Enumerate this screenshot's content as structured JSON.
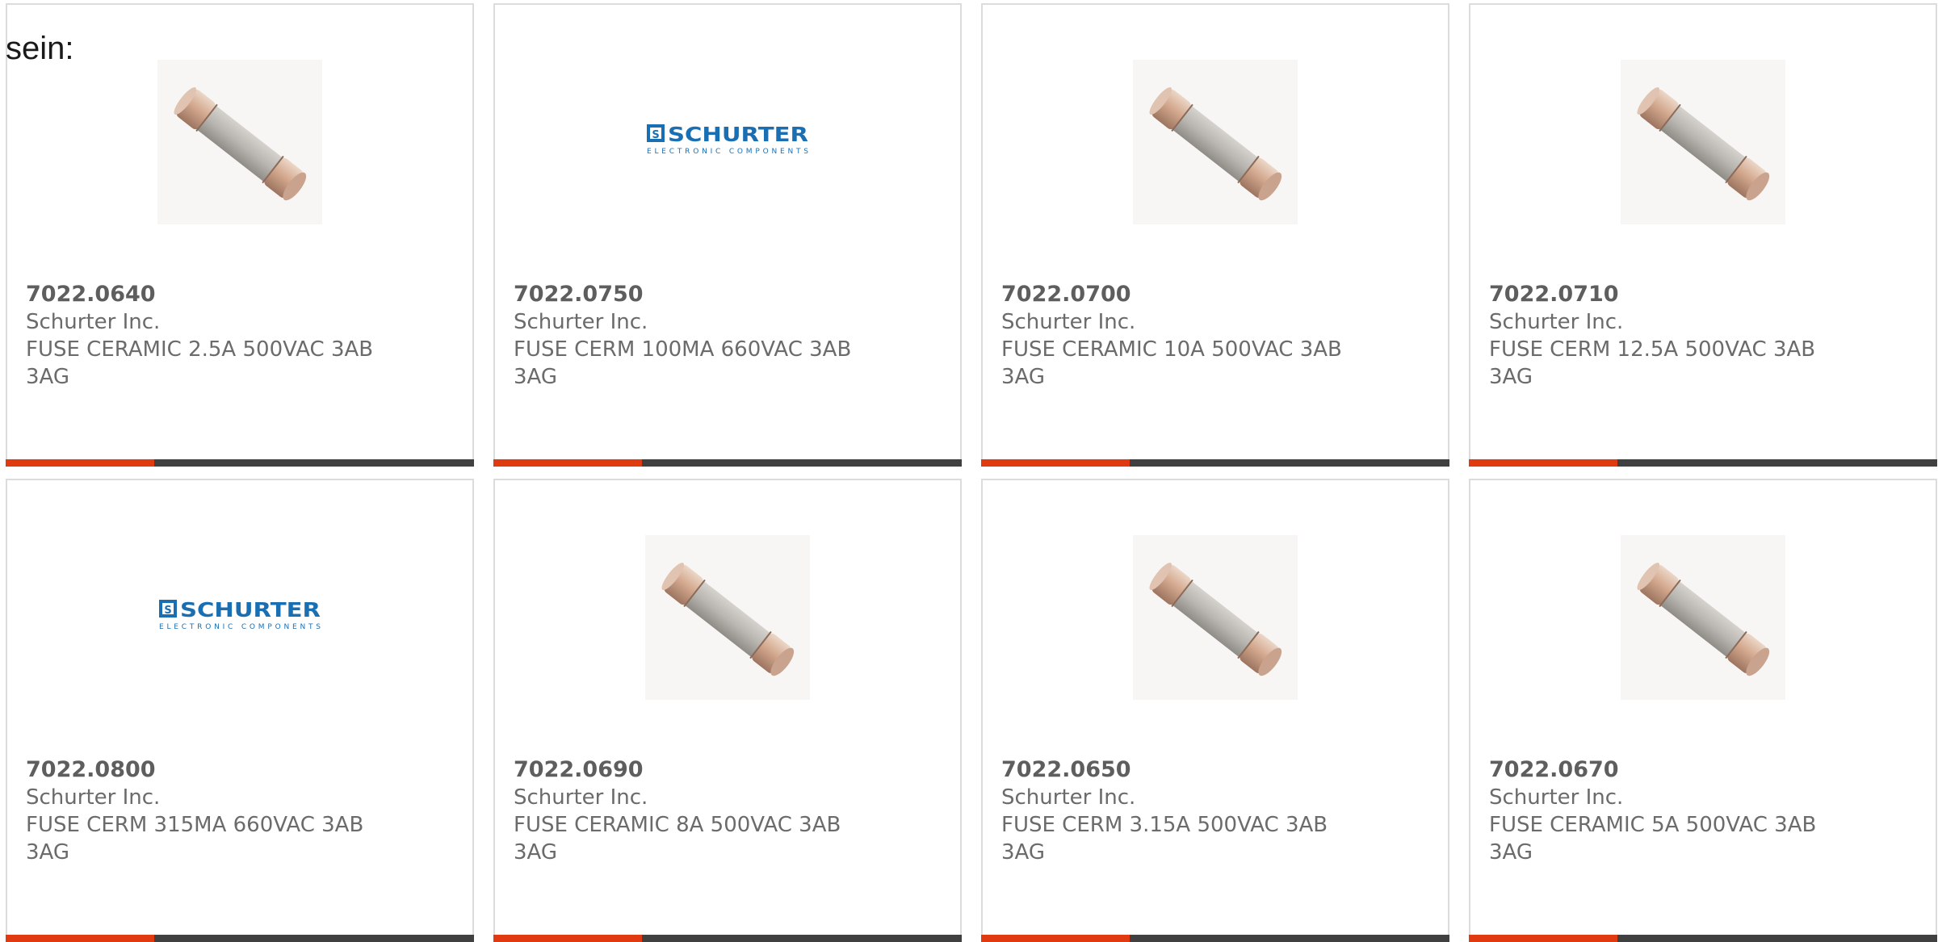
{
  "intro_text": "sein:",
  "colors": {
    "accent": "#e03a10",
    "bar": "#404040",
    "logo_blue": "#1a6fb3"
  },
  "logo": {
    "brand": "SCHURTER",
    "tagline": "ELECTRONIC COMPONENTS"
  },
  "products": [
    {
      "part_number": "7022.0640",
      "manufacturer": "Schurter Inc.",
      "description": "FUSE CERAMIC 2.5A 500VAC 3AB 3AG",
      "image": "fuse-image"
    },
    {
      "part_number": "7022.0750",
      "manufacturer": "Schurter Inc.",
      "description": "FUSE CERM 100MA 660VAC 3AB 3AG",
      "image": "schurter-logo"
    },
    {
      "part_number": "7022.0700",
      "manufacturer": "Schurter Inc.",
      "description": "FUSE CERAMIC 10A 500VAC 3AB 3AG",
      "image": "fuse-image"
    },
    {
      "part_number": "7022.0710",
      "manufacturer": "Schurter Inc.",
      "description": "FUSE CERM 12.5A 500VAC 3AB 3AG",
      "image": "fuse-image"
    },
    {
      "part_number": "7022.0800",
      "manufacturer": "Schurter Inc.",
      "description": "FUSE CERM 315MA 660VAC 3AB 3AG",
      "image": "schurter-logo"
    },
    {
      "part_number": "7022.0690",
      "manufacturer": "Schurter Inc.",
      "description": "FUSE CERAMIC 8A 500VAC 3AB 3AG",
      "image": "fuse-image"
    },
    {
      "part_number": "7022.0650",
      "manufacturer": "Schurter Inc.",
      "description": "FUSE CERM 3.15A 500VAC 3AB 3AG",
      "image": "fuse-image"
    },
    {
      "part_number": "7022.0670",
      "manufacturer": "Schurter Inc.",
      "description": "FUSE CERAMIC 5A 500VAC 3AB 3AG",
      "image": "fuse-image"
    }
  ]
}
